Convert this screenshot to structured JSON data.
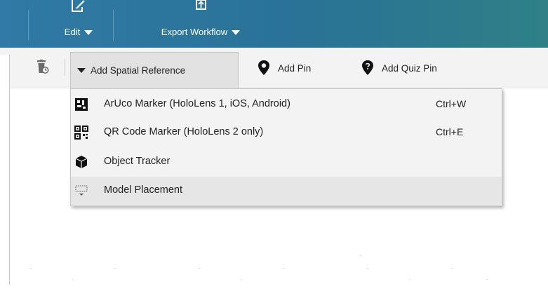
{
  "ribbon": {
    "edit_label": "Edit",
    "edit_icon": "edit-icon",
    "export_label": "Export Workflow",
    "export_icon": "export-icon"
  },
  "toolbar": {
    "delete_icon": "delete-step-icon",
    "add_spatial_reference": "Add Spatial Reference",
    "add_pin": "Add Pin",
    "add_pin_icon": "map-pin-icon",
    "add_quiz_pin": "Add Quiz Pin",
    "add_quiz_pin_icon": "quiz-pin-icon"
  },
  "menu": {
    "items": [
      {
        "label": "ArUco Marker (HoloLens 1, iOS, Android)",
        "shortcut": "Ctrl+W",
        "icon": "aruco-marker-icon"
      },
      {
        "label": "QR Code Marker (HoloLens 2 only)",
        "shortcut": "Ctrl+E",
        "icon": "qr-code-icon"
      },
      {
        "label": "Object Tracker",
        "shortcut": "",
        "icon": "cube-icon"
      },
      {
        "label": "Model Placement",
        "shortcut": "",
        "icon": "model-placement-icon"
      }
    ],
    "hovered_index": 3
  },
  "colors": {
    "ribbon": "#2a7296",
    "toolbar": "#f3f3f3",
    "menu": "#f3f3f3",
    "hover": "#e6e6e6"
  }
}
